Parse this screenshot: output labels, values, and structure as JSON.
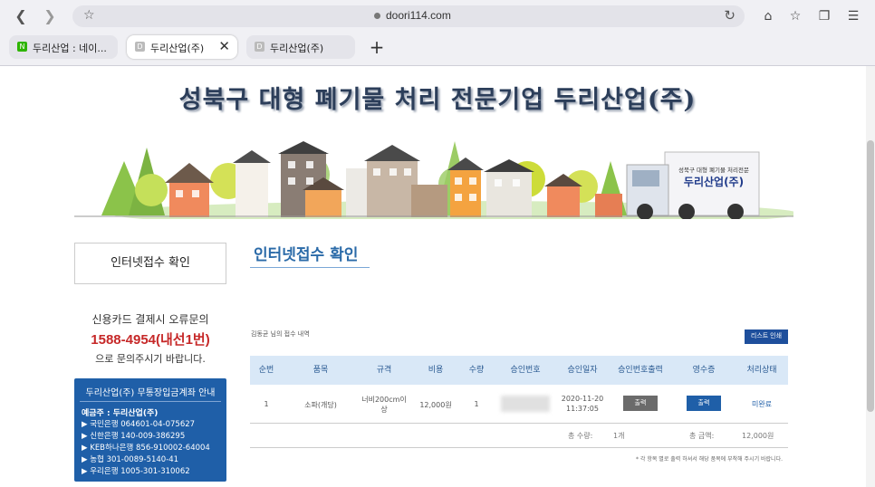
{
  "browser": {
    "url": "doori114.com",
    "tabs": [
      {
        "label": "두리산업 : 네이...",
        "favicon": "N"
      },
      {
        "label": "두리산업(주)",
        "favicon": "D"
      },
      {
        "label": "두리산업(주)",
        "favicon": "D"
      }
    ],
    "icons": [
      "back-icon",
      "forward-icon",
      "star-icon",
      "lock-icon",
      "reload-icon",
      "home-icon",
      "bookmark-icon",
      "extensions-icon",
      "menu-icon",
      "close-icon",
      "plus-icon"
    ]
  },
  "site": {
    "banner_title": "성북구 대형 폐기물 처리 전문기업 두리산업(주)",
    "truck_small": "성북구 대형 폐기물 처리전문",
    "truck_big": "두리산업(주)"
  },
  "sidebar": {
    "menu_label": "인터넷접수 확인",
    "card_question": "신용카드 결제시 오류문의",
    "card_phone": "1588-4954(내선1번)",
    "card_ask": "으로 문의주시기 바랍니다.",
    "bank_title": "두리산업(주) 무통장입금계좌 안내",
    "bank_holder": "예금주 : 두리산업(주)",
    "bank_accounts": [
      "▶ 국민은행 064601-04-075627",
      "▶ 신한은행 140-009-386295",
      "▶ KEB하나은행 856-910002-64004",
      "▶ 농협 301-0089-5140-41",
      "▶ 우리은행 1005-301-310062"
    ]
  },
  "main": {
    "title": "인터넷접수 확인",
    "receipt_note": "김동균 님의 접수 내역",
    "print_list_label": "리스트 인쇄",
    "columns": [
      "순번",
      "품목",
      "규격",
      "비용",
      "수량",
      "승인번호",
      "승인일자",
      "승인번호출력",
      "영수증",
      "처리상태"
    ],
    "row": {
      "no": "1",
      "item": "소파(개당)",
      "spec_line1": "너비200cm이",
      "spec_line2": "상",
      "cost": "12,000원",
      "qty": "1",
      "date_line1": "2020-11-20",
      "date_line2": "11:37:05",
      "print_btn": "출력",
      "receipt_btn": "출력",
      "status": "미완료"
    },
    "total_qty_label": "총 수량:",
    "total_qty": "1개",
    "total_amount_label": "총 금액:",
    "total_amount": "12,000원",
    "footnote": "* 각 항목 별로 출력 하셔서 해당 품목에 부착해 주시기 바랍니다."
  },
  "colors": {
    "accent": "#1f5fa8",
    "header_bg": "#d9e8f7",
    "phone": "#c62828",
    "gray_btn": "#6b6b6b"
  }
}
